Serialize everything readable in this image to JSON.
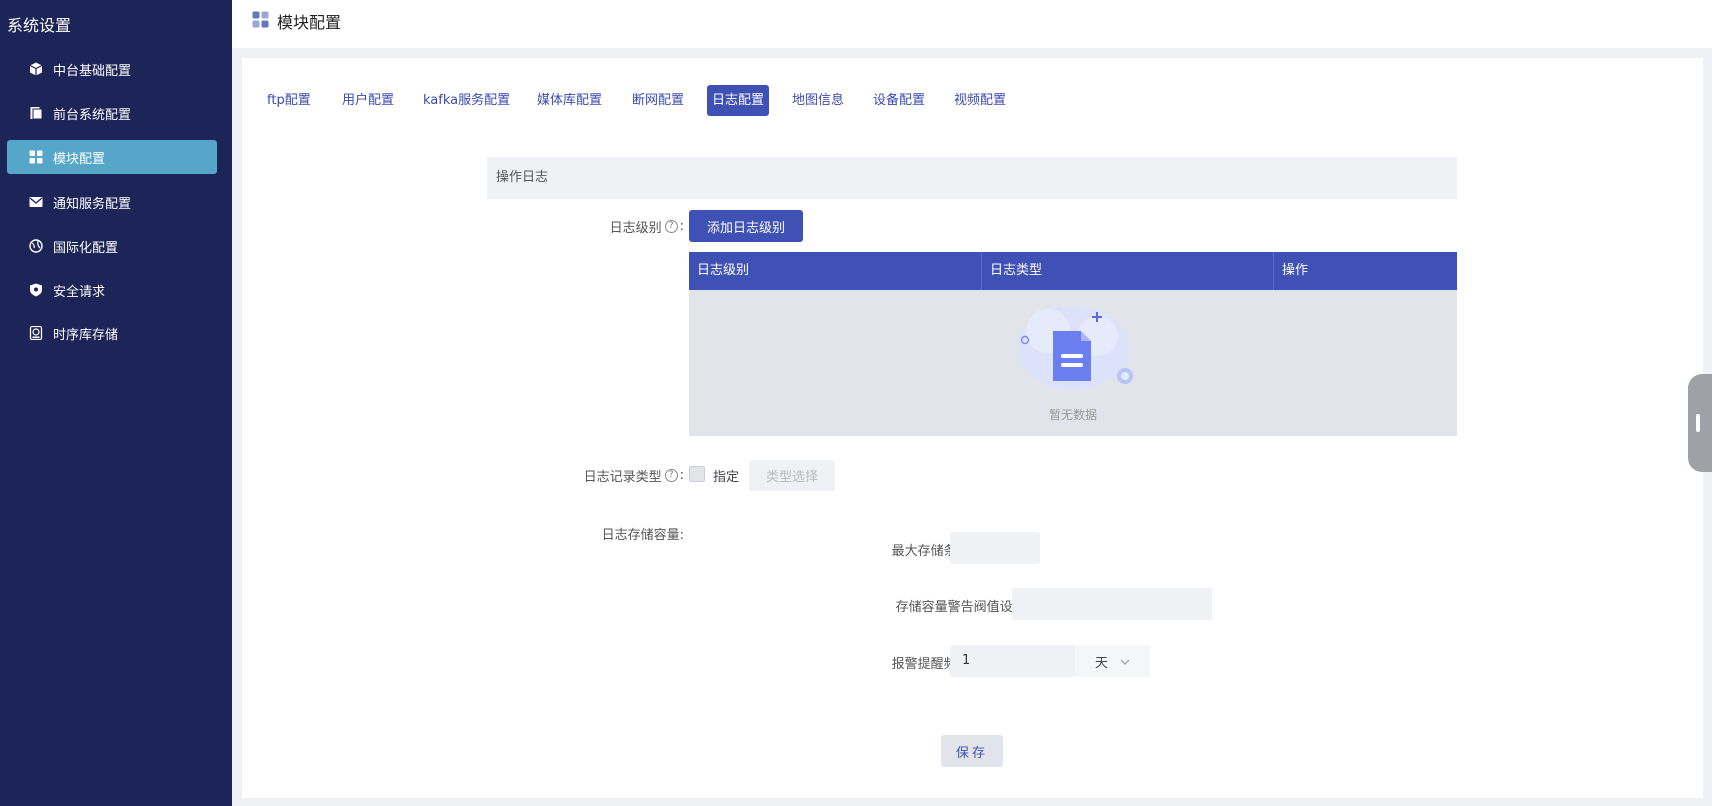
{
  "sidebar": {
    "title": "系统设置",
    "items": [
      {
        "label": "中台基础配置",
        "icon": "cube-icon",
        "active": false
      },
      {
        "label": "前台系统配置",
        "icon": "document-icon",
        "active": false
      },
      {
        "label": "模块配置",
        "icon": "grid-icon",
        "active": true
      },
      {
        "label": "通知服务配置",
        "icon": "mail-icon",
        "active": false
      },
      {
        "label": "国际化配置",
        "icon": "globe-icon",
        "active": false
      },
      {
        "label": "安全请求",
        "icon": "shield-icon",
        "active": false
      },
      {
        "label": "时序库存储",
        "icon": "storage-icon",
        "active": false
      }
    ]
  },
  "header": {
    "title": "模块配置",
    "icon": "grid-icon"
  },
  "tabs": [
    {
      "label": "ftp配置",
      "active": false
    },
    {
      "label": "用户配置",
      "active": false
    },
    {
      "label": "kafka服务配置",
      "active": false
    },
    {
      "label": "媒体库配置",
      "active": false
    },
    {
      "label": "断网配置",
      "active": false
    },
    {
      "label": "日志配置",
      "active": true
    },
    {
      "label": "地图信息",
      "active": false
    },
    {
      "label": "设备配置",
      "active": false
    },
    {
      "label": "视频配置",
      "active": false
    }
  ],
  "section": {
    "title": "操作日志"
  },
  "form": {
    "log_level_label": "日志级别",
    "add_level_button": "添加日志级别",
    "table": {
      "columns": [
        "日志级别",
        "日志类型",
        "操作"
      ],
      "empty_text": "暂无数据"
    },
    "record_type_label": "日志记录类型",
    "specify_label": "指定",
    "type_select_button": "类型选择",
    "storage_label": "日志存储容量:",
    "max_count_label": "最大存储条数",
    "max_count_value": "",
    "threshold_label": "存储容量警告阀值设置",
    "threshold_value": "",
    "alert_freq_label": "报警提醒频率",
    "alert_freq_value": "1",
    "alert_freq_unit": "天",
    "colon": ":",
    "save_button": "保存"
  },
  "colors": {
    "sidebar_bg": "#1d2558",
    "active_menu": "#56a6c9",
    "primary": "#3f51b5"
  }
}
